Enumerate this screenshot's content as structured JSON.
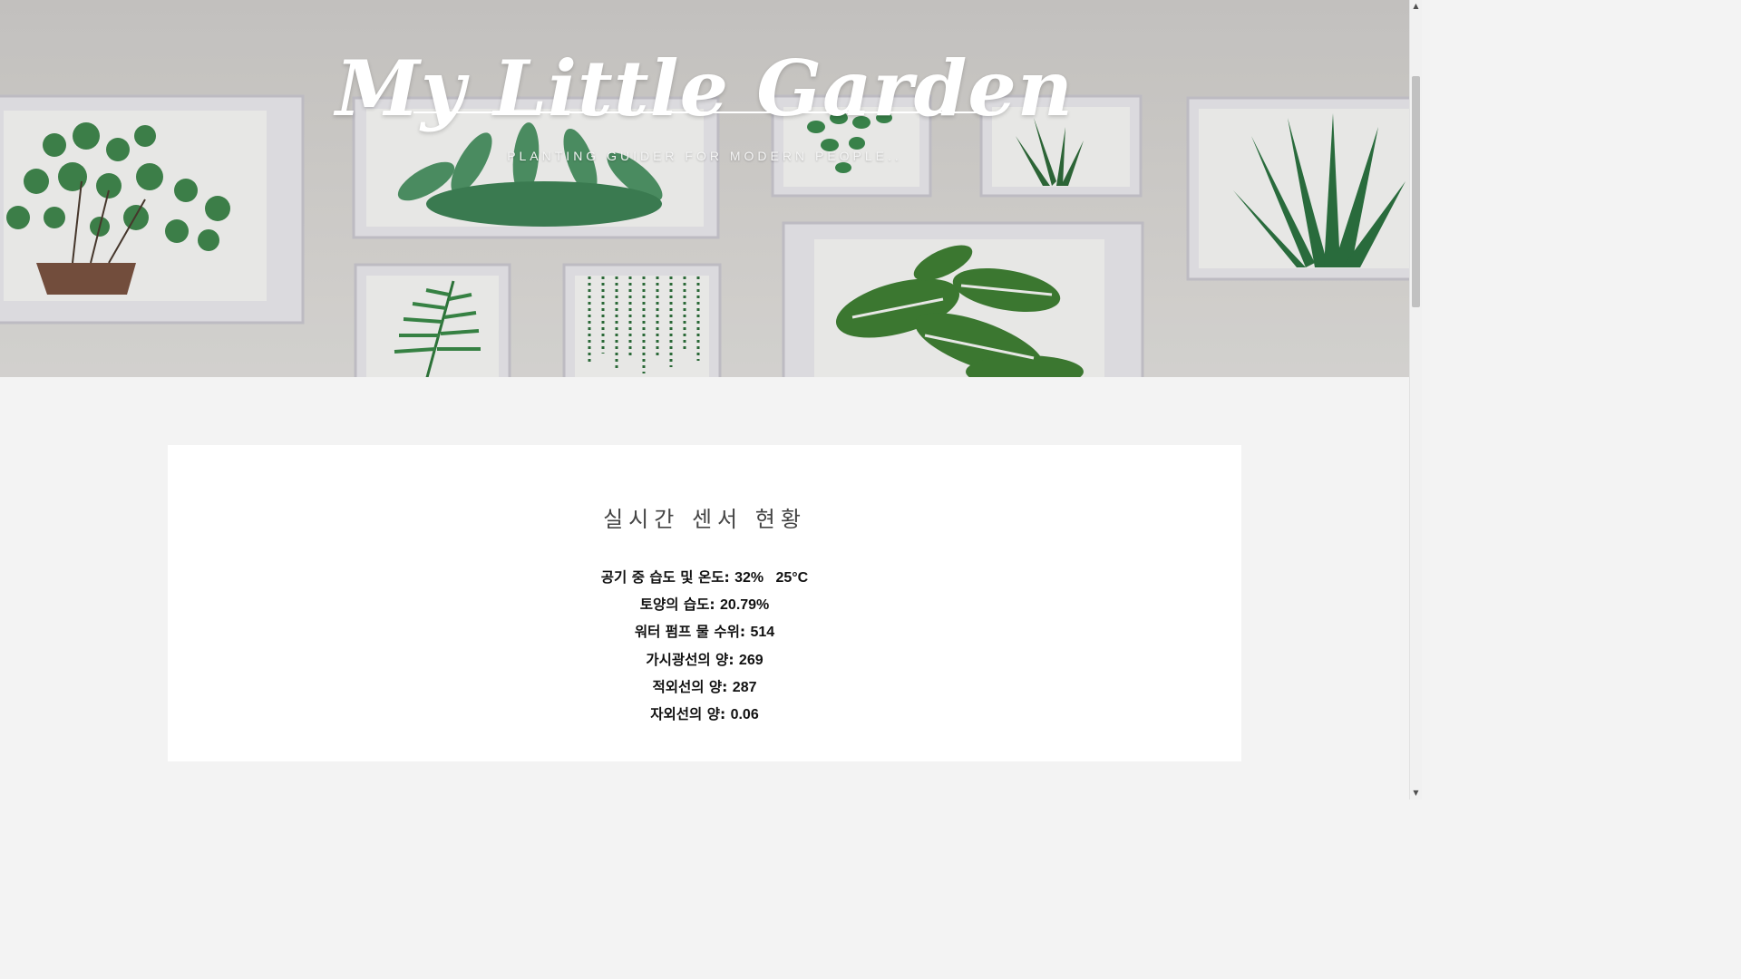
{
  "hero": {
    "title": "My Little Garden",
    "subtitle": "PLANTING GUIDER FOR MODERN PEOPLE.."
  },
  "sensors": {
    "heading": "실시간 센서 현황",
    "rows": [
      {
        "label": "공기 중 습도 및 온도:",
        "value": "32%   25°C"
      },
      {
        "label": "토양의 습도:",
        "value": "20.79%"
      },
      {
        "label": "워터 펌프 물 수위:",
        "value": "514"
      },
      {
        "label": "가시광선의 양:",
        "value": "269"
      },
      {
        "label": "적외선의 양:",
        "value": "287"
      },
      {
        "label": "자외선의 양:",
        "value": "0.06"
      }
    ]
  },
  "icons": {
    "scroll_up": "triangle-up-icon",
    "scroll_down": "triangle-down-icon"
  },
  "colors": {
    "page_bg": "#f3f3f3",
    "card_bg": "#ffffff",
    "hero_text": "#ffffff",
    "plant_green": "#2f7d3a"
  }
}
